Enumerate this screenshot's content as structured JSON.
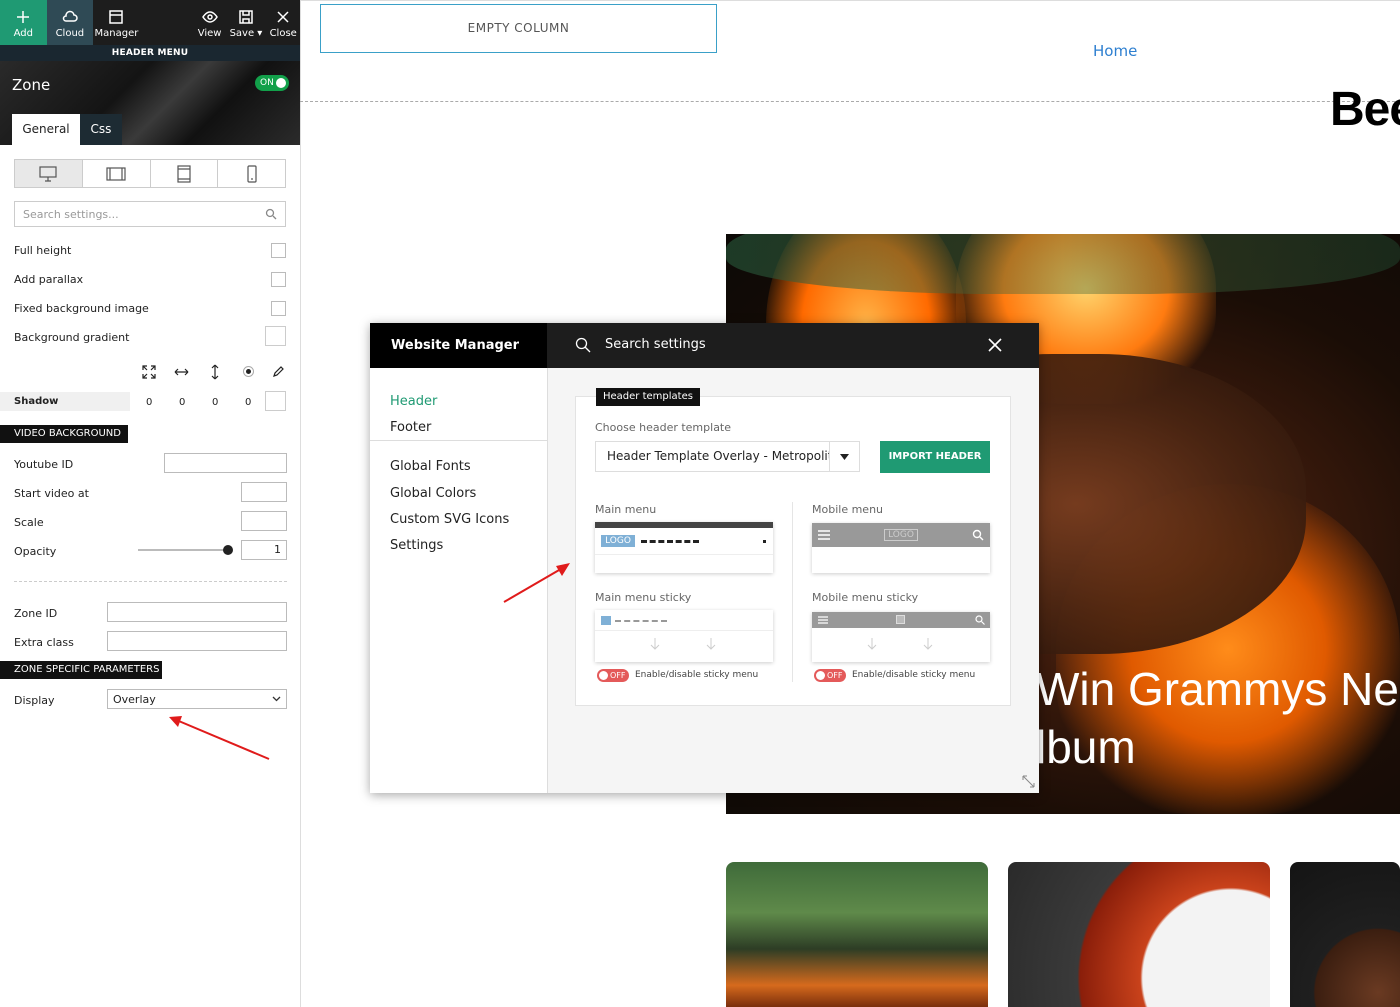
{
  "toolbar": {
    "add": "Add",
    "cloud": "Cloud",
    "manager": "Manager",
    "view": "View",
    "save": "Save ▾",
    "close": "Close"
  },
  "panel": {
    "header_menu": "HEADER MENU",
    "zone_title": "Zone",
    "zone_toggle": "ON",
    "tabs": [
      "General",
      "Css"
    ],
    "search_placeholder": "Search settings...",
    "options": [
      "Full height",
      "Add parallax",
      "Fixed background image",
      "Background gradient"
    ],
    "shadow_label": "Shadow",
    "shadow_values": [
      "0",
      "0",
      "0",
      "0"
    ],
    "video_section": "VIDEO BACKGROUND",
    "youtube_label": "Youtube ID",
    "start_label": "Start video at",
    "scale_label": "Scale",
    "opacity_label": "Opacity",
    "opacity_value": "1",
    "zone_id_label": "Zone ID",
    "extra_class_label": "Extra class",
    "zone_specific_section": "ZONE SPECIFIC PARAMETERS",
    "display_label": "Display",
    "display_value": "Overlay"
  },
  "canvas": {
    "empty_column": "EMPTY COLUMN",
    "home_link": "Home",
    "partial_heading": "Bee",
    "hero_line1": "Win Grammys Ne",
    "hero_line2": "lbum"
  },
  "manager": {
    "title": "Website Manager",
    "search_label": "Search settings",
    "nav": [
      "Header",
      "Footer",
      "Global Fonts",
      "Global Colors",
      "Custom SVG Icons",
      "Settings"
    ],
    "templates_badge": "Header templates",
    "choose_label": "Choose header template",
    "selected_template": "Header Template Overlay - Metropolitan",
    "import_button": "IMPORT HEADER",
    "main_menu": "Main menu",
    "mobile_menu": "Mobile menu",
    "main_menu_sticky": "Main menu sticky",
    "mobile_menu_sticky": "Mobile menu sticky",
    "logo_text": "LOGO",
    "sticky_toggle": "OFF",
    "sticky_label": "Enable/disable sticky menu"
  },
  "colors": {
    "accent_green": "#1f9a73",
    "toggle_on": "#12a04a",
    "toggle_off": "#e45a5a",
    "link_blue": "#2d7fd0",
    "annotation_red": "#e01b1b"
  }
}
